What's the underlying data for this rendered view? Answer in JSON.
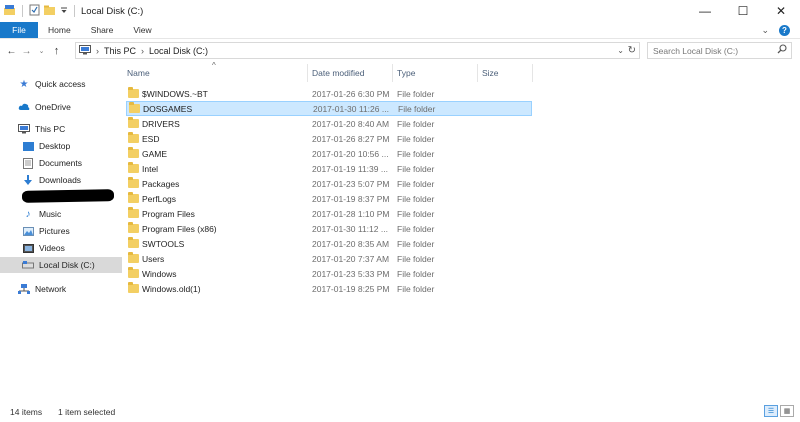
{
  "window": {
    "title": "Local Disk (C:)",
    "minimize": "—",
    "maximize": "☐",
    "close": "✕"
  },
  "ribbon": {
    "tabs": [
      "File",
      "Home",
      "Share",
      "View"
    ],
    "expand_icon": "⌄",
    "help": "?"
  },
  "address": {
    "breadcrumb": [
      "This PC",
      "Local Disk (C:)"
    ],
    "search_placeholder": "Search Local Disk (C:)"
  },
  "nav": {
    "items": [
      {
        "label": "Quick access",
        "icon": "star-icon"
      },
      {
        "label": "OneDrive",
        "icon": "cloud-icon"
      },
      {
        "label": "This PC",
        "icon": "computer-icon"
      },
      {
        "label": "Desktop",
        "icon": "desktop-icon"
      },
      {
        "label": "Documents",
        "icon": "documents-icon"
      },
      {
        "label": "Downloads",
        "icon": "download-icon"
      },
      {
        "label": "Music",
        "icon": "music-icon"
      },
      {
        "label": "Pictures",
        "icon": "pictures-icon"
      },
      {
        "label": "Videos",
        "icon": "videos-icon"
      },
      {
        "label": "Local Disk (C:)",
        "icon": "drive-icon"
      },
      {
        "label": "Network",
        "icon": "network-icon"
      }
    ]
  },
  "columns": [
    "Name",
    "Date modified",
    "Type",
    "Size"
  ],
  "files": [
    {
      "name": "$WINDOWS.~BT",
      "date": "2017-01-26 6:30 PM",
      "type": "File folder"
    },
    {
      "name": "DOSGAMES",
      "date": "2017-01-30 11:26 ...",
      "type": "File folder"
    },
    {
      "name": "DRIVERS",
      "date": "2017-01-20 8:40 AM",
      "type": "File folder"
    },
    {
      "name": "ESD",
      "date": "2017-01-26 8:27 PM",
      "type": "File folder"
    },
    {
      "name": "GAME",
      "date": "2017-01-20 10:56 ...",
      "type": "File folder"
    },
    {
      "name": "Intel",
      "date": "2017-01-19 11:39 ...",
      "type": "File folder"
    },
    {
      "name": "Packages",
      "date": "2017-01-23 5:07 PM",
      "type": "File folder"
    },
    {
      "name": "PerfLogs",
      "date": "2017-01-19 8:37 PM",
      "type": "File folder"
    },
    {
      "name": "Program Files",
      "date": "2017-01-28 1:10 PM",
      "type": "File folder"
    },
    {
      "name": "Program Files (x86)",
      "date": "2017-01-30 11:12 ...",
      "type": "File folder"
    },
    {
      "name": "SWTOOLS",
      "date": "2017-01-20 8:35 AM",
      "type": "File folder"
    },
    {
      "name": "Users",
      "date": "2017-01-20 7:37 AM",
      "type": "File folder"
    },
    {
      "name": "Windows",
      "date": "2017-01-23 5:33 PM",
      "type": "File folder"
    },
    {
      "name": "Windows.old(1)",
      "date": "2017-01-19 8:25 PM",
      "type": "File folder"
    }
  ],
  "status": {
    "count": "14 items",
    "selection": "1 item selected"
  },
  "colors": {
    "accent": "#1979ca",
    "selection": "#cce8ff",
    "folder": "#f3cf63"
  }
}
